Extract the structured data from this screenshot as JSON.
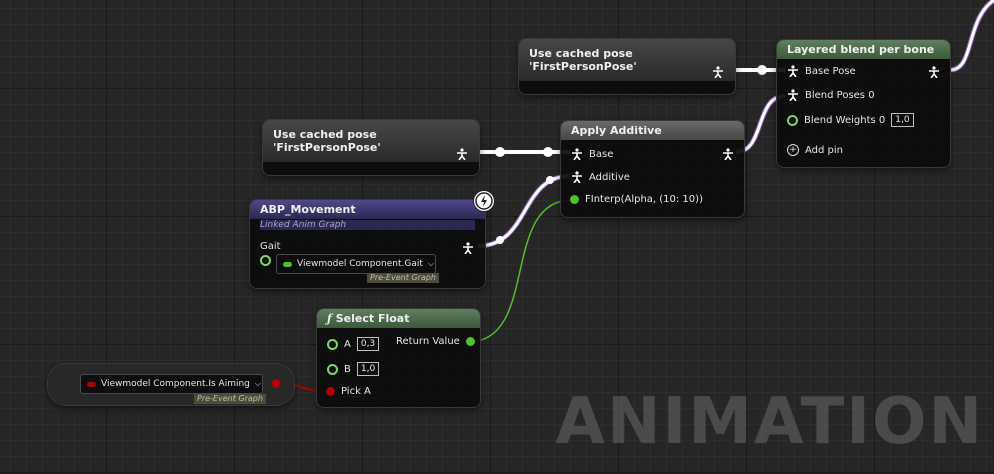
{
  "watermark": "ANIMATION",
  "nodes": {
    "cached_pose_top": {
      "title": "Use cached pose 'FirstPersonPose'"
    },
    "cached_pose_mid": {
      "title": "Use cached pose 'FirstPersonPose'"
    },
    "layered_blend": {
      "title": "Layered blend per bone",
      "pins": {
        "base_pose": "Base Pose",
        "blend_poses": "Blend Poses 0",
        "blend_weights": "Blend Weights 0",
        "blend_weights_value": "1,0",
        "add_pin": "Add pin"
      }
    },
    "apply_additive": {
      "title": "Apply Additive",
      "pins": {
        "base": "Base",
        "additive": "Additive",
        "alpha": "FInterp(Alpha, (10: 10))"
      }
    },
    "abp_movement": {
      "title": "ABP_Movement",
      "subtitle": "Linked Anim Graph",
      "pins": {
        "gait": "Gait"
      },
      "gait_value": "Viewmodel Component.Gait",
      "tag": "Pre-Event Graph"
    },
    "select_float": {
      "title": "Select Float",
      "pins": {
        "a": "A",
        "a_value": "0,3",
        "b": "B",
        "b_value": "1,0",
        "pick_a": "Pick A",
        "return_value": "Return Value"
      }
    },
    "is_aiming": {
      "value": "Viewmodel Component.Is Aiming",
      "tag": "Pre-Event Graph"
    }
  },
  "colors": {
    "pose_wire": "#ffffff",
    "pose_wire_glow": "#a66fe0",
    "float_wire": "#4ec22c",
    "bool_pin": "#b00000",
    "header_green": "#4a6a4a",
    "header_blue": "#3a366c"
  }
}
